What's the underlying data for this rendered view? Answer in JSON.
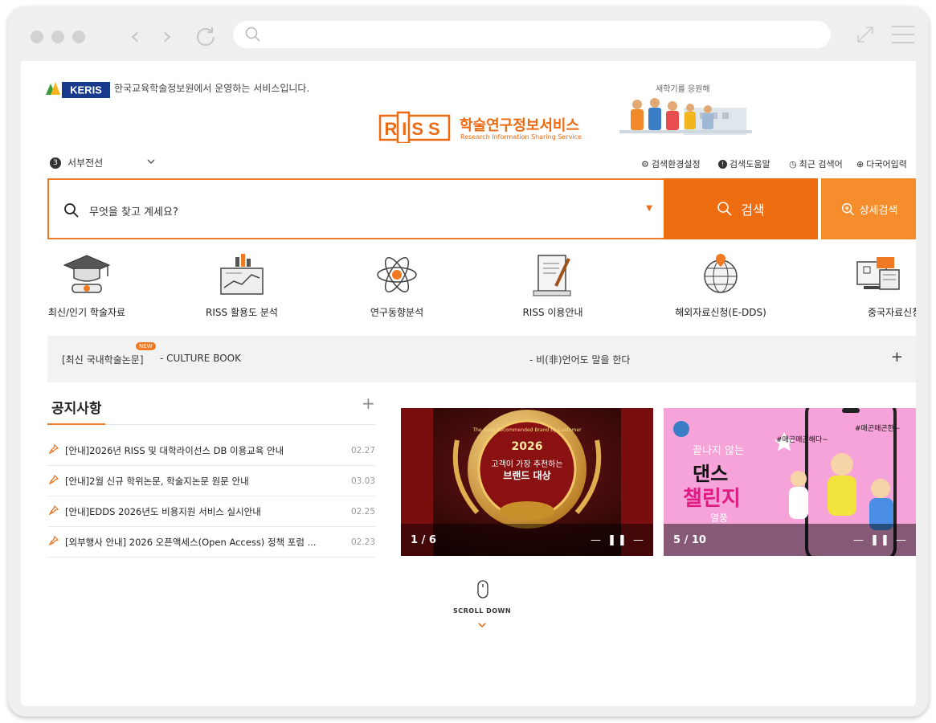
{
  "browser": {
    "url": ""
  },
  "header": {
    "keris_label": "KERIS",
    "keris_text": "한국교육학술정보원에서 운영하는 서비스입니다.",
    "campaign_text": "새학기를 응원해",
    "riss_label": "RISS",
    "riss_title_ko": "학술연구정보서비스",
    "riss_title_en": "Research Information Sharing Service"
  },
  "user": {
    "badge": "3",
    "name": "서부전선"
  },
  "utility_links": [
    {
      "label": "검색환경설정",
      "icon": "gear-icon"
    },
    {
      "label": "검색도움말",
      "icon": "info-icon"
    },
    {
      "label": "최근 검색어",
      "icon": "clock-icon"
    },
    {
      "label": "다국어입력",
      "icon": "globe-icon"
    }
  ],
  "search": {
    "placeholder": "무엇을 찾고 계세요?",
    "button_label": "검색",
    "advanced_label": "상세검색"
  },
  "quick_links": [
    {
      "label": "최신/인기 학술자료",
      "icon": "graduation-cap-icon"
    },
    {
      "label": "RISS 활용도 분석",
      "icon": "analytics-chart-icon"
    },
    {
      "label": "연구동향분석",
      "icon": "atom-icon"
    },
    {
      "label": "RISS 이용안내",
      "icon": "document-pen-icon"
    },
    {
      "label": "해외자료신청(E-DDS)",
      "icon": "globe-pin-icon"
    },
    {
      "label": "중국자료신청",
      "icon": "computer-book-icon"
    }
  ],
  "ticker": {
    "category": "[최신 국내학술논문]",
    "badge": "NEW",
    "item1": "- CULTURE BOOK",
    "item2": "- 비(非)언어도 말을 한다"
  },
  "notices": {
    "title": "공지사항",
    "items": [
      {
        "text": "[안내]2026년 RISS 및 대학라이선스 DB 이용교육 안내",
        "date": "02.27"
      },
      {
        "text": "[안내]2월 신규 학위논문, 학술지논문 원문 안내",
        "date": "03.03"
      },
      {
        "text": "[안내]EDDS 2026년도 비용지원 서비스 실시안내",
        "date": "02.25"
      },
      {
        "text": "[외부행사 안내] 2026 오픈액세스(Open Access) 정책 포럼 ...",
        "date": "02.23"
      }
    ]
  },
  "banners": [
    {
      "year": "2026",
      "line1": "고객이 가장 추천하는",
      "line2": "브랜드 대상",
      "ring_text": "The most Recommended Brand by Customer",
      "count": "1 / 6"
    },
    {
      "line1": "끝나지 않는",
      "line2": "댄스",
      "line3": "챌린지",
      "line4": "열풍",
      "tag1": "#매곤매곤해다~",
      "tag2": "#매곤매곤한~",
      "count": "5 / 10"
    }
  ],
  "scroll": {
    "label": "SCROLL DOWN"
  }
}
